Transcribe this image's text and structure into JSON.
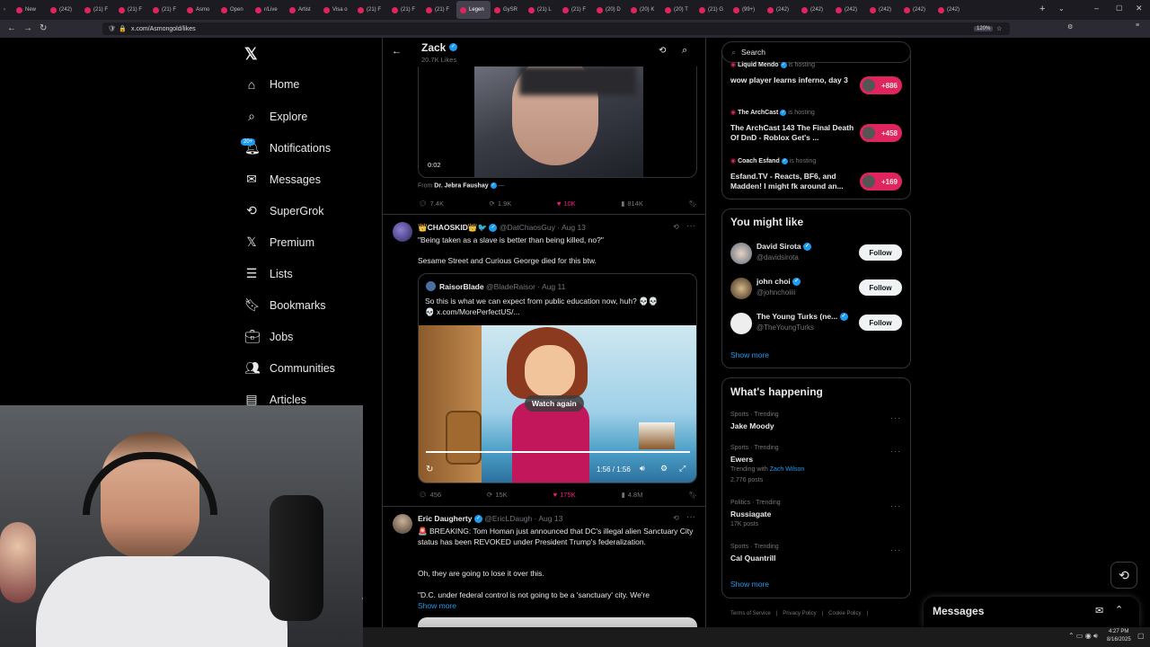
{
  "browser": {
    "tabs": [
      "New",
      "(242)",
      "(21) F",
      "(21) F",
      "(21) F",
      "Asmo",
      "Open",
      "r/Live",
      "Artist",
      "Visa o",
      "(21) F",
      "(21) F",
      "(21) F",
      "Legen",
      "GySR",
      "(21) L",
      "(21) F",
      "(20) D",
      "(20) K",
      "(20) T",
      "(21) G",
      "(99+)",
      "(242)",
      "(242)",
      "(242)",
      "(242)",
      "(242)",
      "(242)"
    ],
    "url": "x.com/Asmongold/likes",
    "zoom": "120%"
  },
  "nav": {
    "items": [
      {
        "label": "Home",
        "icon": "home-icon"
      },
      {
        "label": "Explore",
        "icon": "search-icon"
      },
      {
        "label": "Notifications",
        "icon": "bell-icon"
      },
      {
        "label": "Messages",
        "icon": "mail-icon"
      },
      {
        "label": "SuperGrok",
        "icon": "grok-icon"
      },
      {
        "label": "Premium",
        "icon": "x-logo-icon"
      },
      {
        "label": "Lists",
        "icon": "list-icon"
      },
      {
        "label": "Bookmarks",
        "icon": "bookmark-icon"
      },
      {
        "label": "Jobs",
        "icon": "briefcase-icon"
      },
      {
        "label": "Communities",
        "icon": "people-icon"
      },
      {
        "label": "Articles",
        "icon": "article-icon"
      }
    ],
    "notif_badge": "20+"
  },
  "header": {
    "name": "Zack",
    "sub": "20.7K Likes"
  },
  "post1": {
    "time": "0:02",
    "from_label": "From",
    "from_name": "Dr. Jebra Faushay",
    "replies": "7.4K",
    "reposts": "1.9K",
    "likes": "10K",
    "views": "814K"
  },
  "post2": {
    "name": "👑CHAOSKID👑🐦",
    "handle": "@DatChaosGuy",
    "date": "· Aug 13",
    "text1": "\"Being taken as a slave is better than being killed, no?\"",
    "text2": "Sesame Street and Curious George died for this btw.",
    "quote_name": "RaisorBlade",
    "quote_handle": "@BladeRaisor",
    "quote_date": "· Aug 11",
    "quote_text": "So this is what we can expect from public education now, huh? 💀💀",
    "quote_link": "💀 x.com/MorePerfectUS/...",
    "watch_again": "Watch again",
    "video_time": "1:56 / 1:56",
    "replies": "456",
    "reposts": "15K",
    "likes": "175K",
    "views": "4.8M"
  },
  "post3": {
    "name": "Eric Daugherty",
    "handle": "@EricLDaugh",
    "date": "· Aug 13",
    "text1": "🚨 BREAKING: Tom Homan just announced that DC's illegal alien Sanctuary City status has been REVOKED under President Trump's federalization.",
    "text2": "Oh, they are going to lose it over this.",
    "text3": "\"D.C. under federal control is not going to be a 'sanctuary' city. We're",
    "show_more": "Show more"
  },
  "search": {
    "placeholder": "Search"
  },
  "live": [
    {
      "host": "Liquid Mendo",
      "status": "is hosting",
      "title": "wow player learns inferno, day 3",
      "count": "+886"
    },
    {
      "host": "The ArchCast",
      "status": "is hosting",
      "title": "The ArchCast 143 The Final Death Of DnD - Roblox Get's ...",
      "count": "+458"
    },
    {
      "host": "Coach Esfand",
      "status": "is hosting",
      "title": "Esfand.TV - Reacts, BF6, and Madden! I might fk around an...",
      "count": "+169"
    }
  ],
  "might_like": {
    "title": "You might like",
    "users": [
      {
        "name": "David Sirota",
        "handle": "@davidsirota",
        "follow": "Follow"
      },
      {
        "name": "john choi",
        "handle": "@johnchoiiii",
        "follow": "Follow"
      },
      {
        "name": "The Young Turks (ne...",
        "handle": "@TheYoungTurks",
        "follow": "Follow"
      }
    ],
    "show_more": "Show more"
  },
  "happening": {
    "title": "What's happening",
    "trends": [
      {
        "meta": "Sports · Trending",
        "title": "Jake Moody",
        "extra": "",
        "posts": ""
      },
      {
        "meta": "Sports · Trending",
        "title": "Ewers",
        "extra_prefix": "Trending with",
        "extra": "Zach Wilson",
        "posts": "2,776 posts"
      },
      {
        "meta": "Politics · Trending",
        "title": "Russiagate",
        "extra": "",
        "posts": "17K posts"
      },
      {
        "meta": "Sports · Trending",
        "title": "Cal Quantrill",
        "extra": "",
        "posts": ""
      }
    ],
    "show_more": "Show more"
  },
  "footer": {
    "links": [
      "Terms of Service",
      "Privacy Policy",
      "Cookie Policy"
    ]
  },
  "messages_drawer": {
    "title": "Messages"
  },
  "taskbar": {
    "time": "4:27 PM",
    "date": "8/16/2025"
  }
}
